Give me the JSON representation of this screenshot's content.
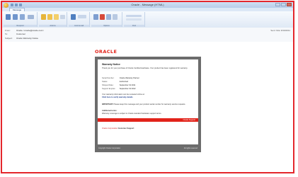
{
  "window": {
    "title": "Oracle - Message (HTML)",
    "buttons": [
      "minimize",
      "maximize",
      "close"
    ]
  },
  "ribbon": {
    "active_tab": "Message",
    "groups": [
      {
        "label": "Respond"
      },
      {
        "label": "Actions"
      },
      {
        "label": "Junk E-mail"
      },
      {
        "label": "Options"
      },
      {
        "label": "Find"
      }
    ]
  },
  "header": {
    "from_label": "From:",
    "from_value": "Oracle <oracle@oracle.com>",
    "to_label": "To:",
    "to_value": "Customer",
    "subject_label": "Subject:",
    "subject_value": "Oracle Warranty Notice",
    "sent_label": "Sent: Mon 9/19/2011"
  },
  "email": {
    "logo_text": "ORACLE",
    "title": "Warranty Notice",
    "intro": "Thank you for your purchase of Oracle Certified Hardware. Your product has been registered for warranty.",
    "fields": [
      {
        "label": "Serial Number:",
        "value": "Oracle Warranty Partner"
      },
      {
        "label": "Status:",
        "value": "Authorized"
      },
      {
        "label": "Shipped Date:",
        "value": "September 19 2011"
      },
      {
        "label": "Support Expires:",
        "value": "September 19 2012"
      }
    ],
    "link_intro": "Your warranty information can be reviewed online at:",
    "link_text": "Click here to verify warranty details",
    "note_label": "IMPORTANT:",
    "note_text": "Please keep this message and your product serial number for warranty service requests.",
    "extra_label": "Additional terms:",
    "extra_text": "Warranty coverage is subject to Oracle standard hardware support terms.",
    "redbar_text": "Oracle Support",
    "signoff_red": "Oracle Corporation",
    "signoff_dark": "Customer Support",
    "footer_left": "Copyright Oracle Corporation",
    "footer_right": "All rights reserved"
  }
}
